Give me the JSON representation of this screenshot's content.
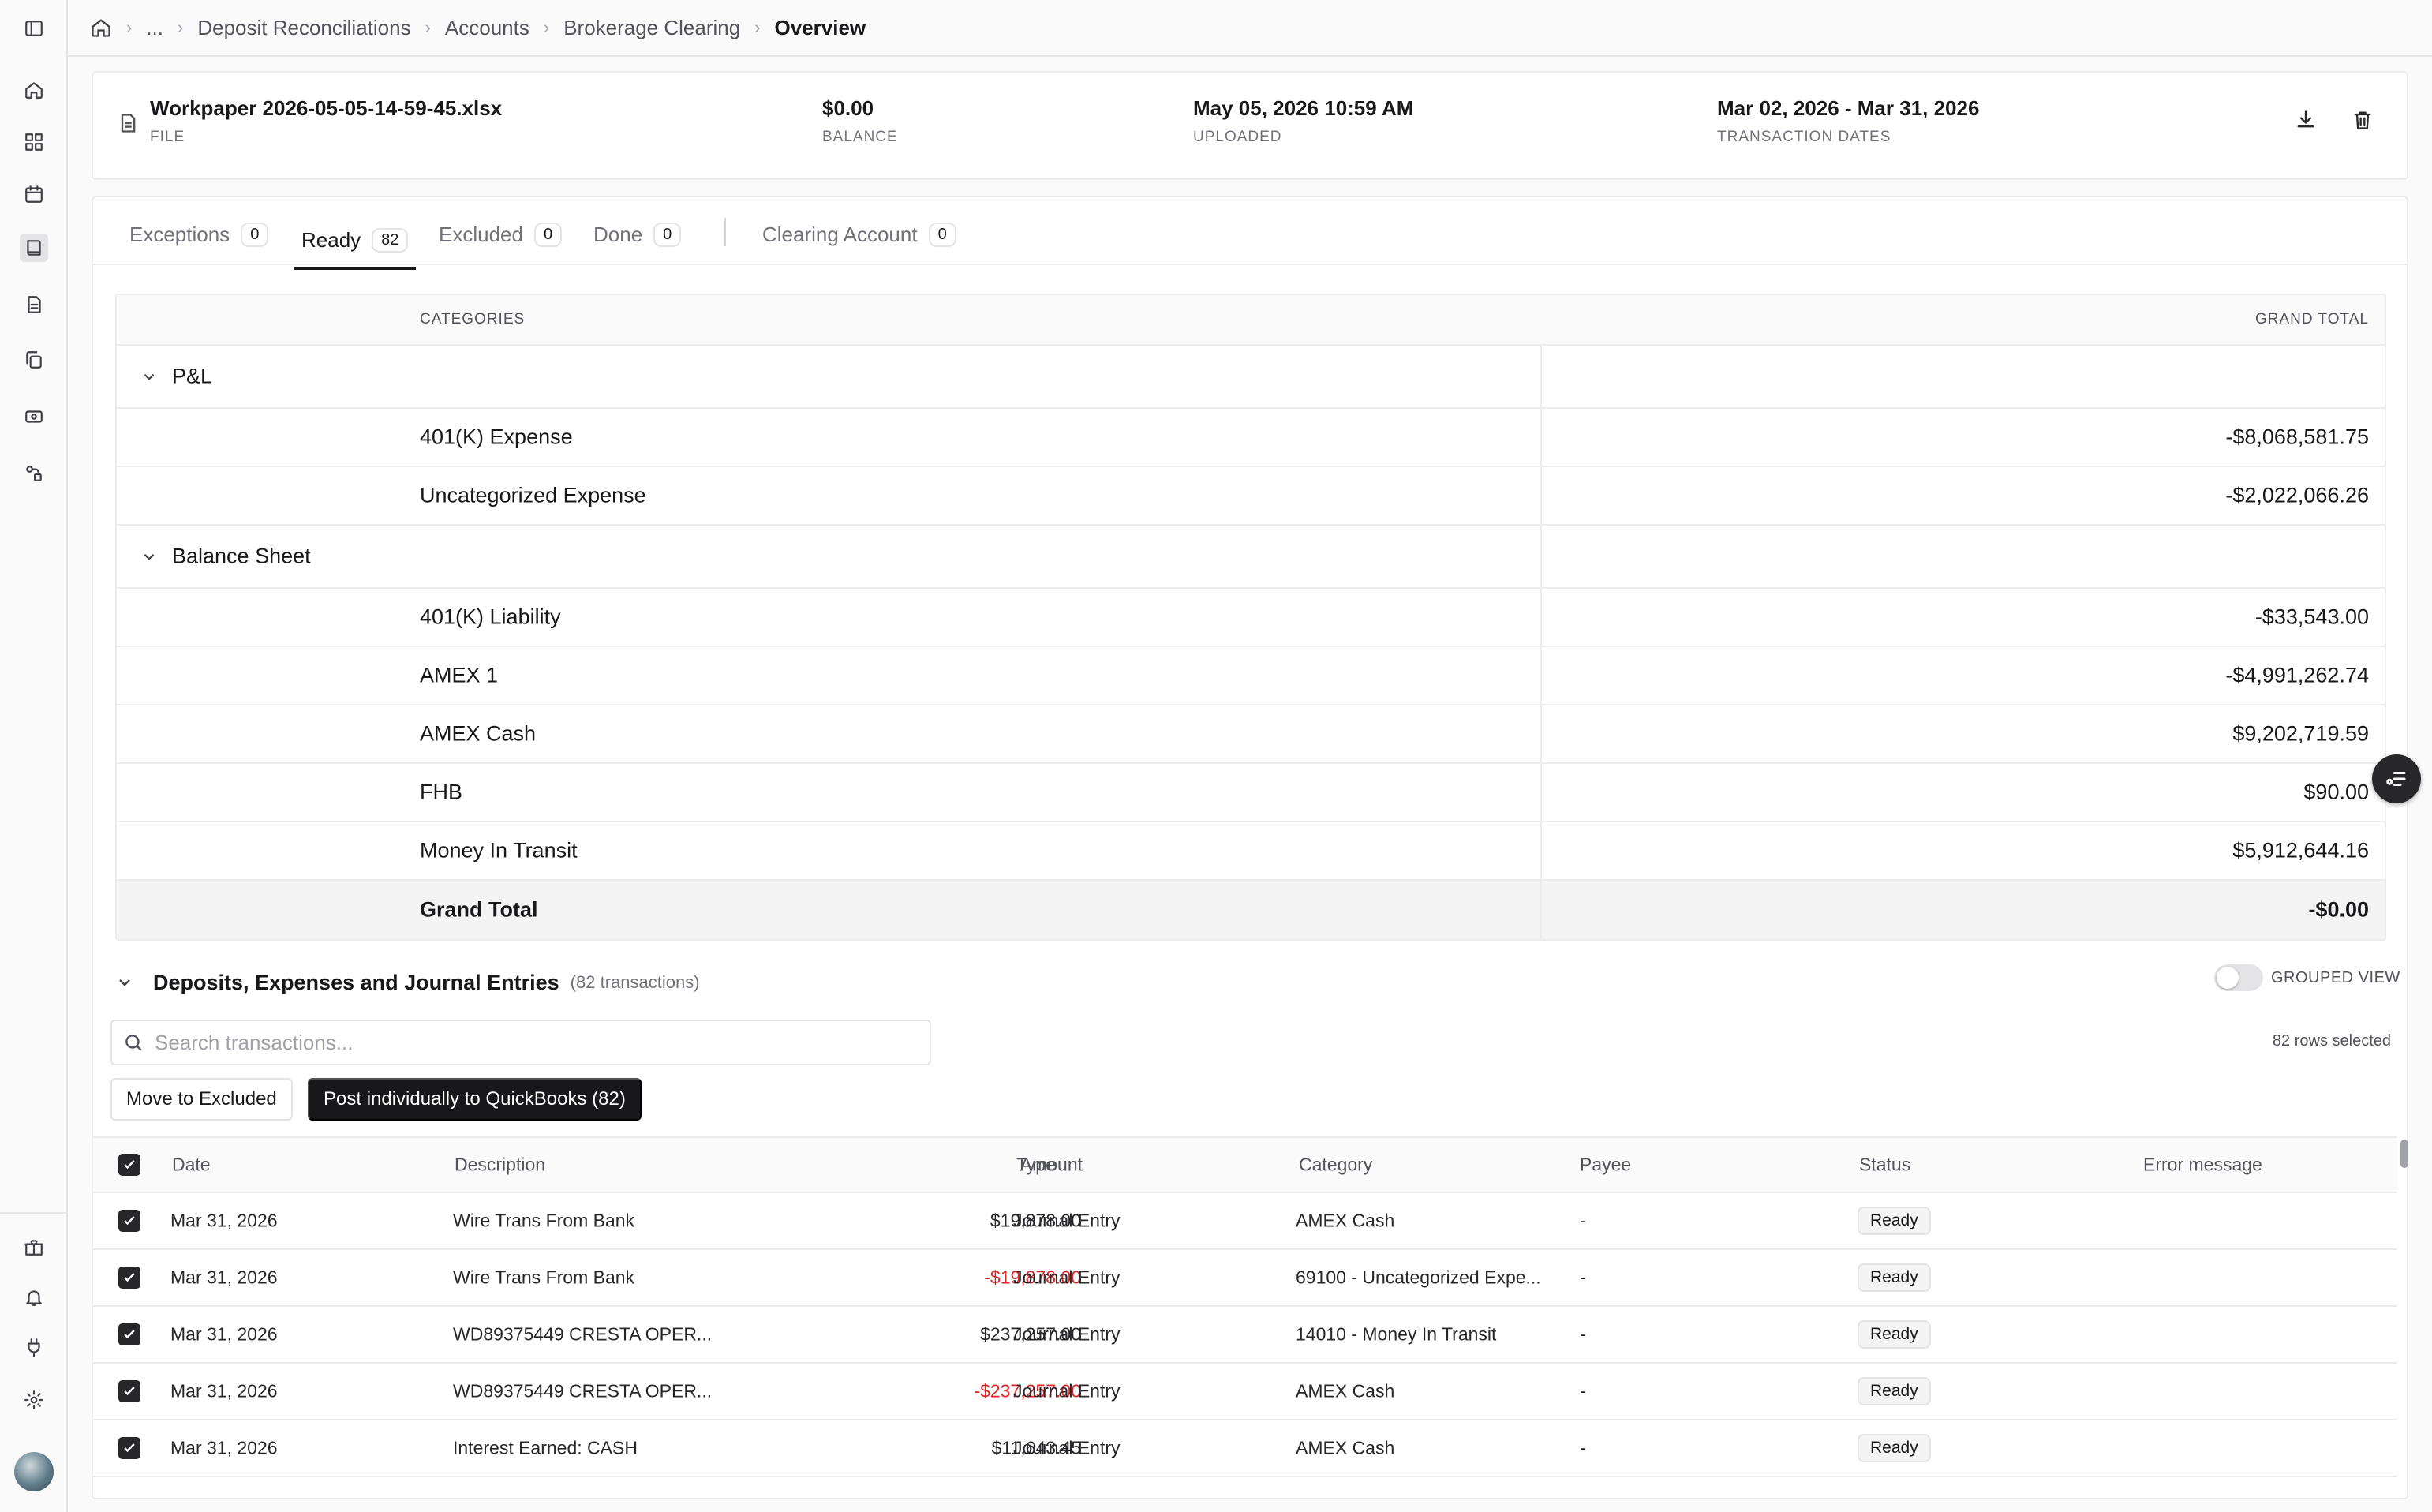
{
  "breadcrumb": {
    "ellipsis": "...",
    "items": [
      "Deposit Reconciliations",
      "Accounts",
      "Brokerage Clearing"
    ],
    "current": "Overview"
  },
  "file_card": {
    "file_name": "Workpaper 2026-05-05-14-59-45.xlsx",
    "file_label": "FILE",
    "balance": "$0.00",
    "balance_label": "BALANCE",
    "uploaded": "May 05, 2026 10:59 AM",
    "uploaded_label": "UPLOADED",
    "dates": "Mar 02, 2026 - Mar 31, 2026",
    "dates_label": "TRANSACTION DATES"
  },
  "tabs": [
    {
      "label": "Exceptions",
      "count": "0"
    },
    {
      "label": "Ready",
      "count": "82"
    },
    {
      "label": "Excluded",
      "count": "0"
    },
    {
      "label": "Done",
      "count": "0"
    },
    {
      "label": "Clearing Account",
      "count": "0"
    }
  ],
  "summary": {
    "header_categories": "CATEGORIES",
    "header_total": "GRAND TOTAL",
    "groups": [
      {
        "name": "P&L",
        "rows": [
          {
            "category": "401(K) Expense",
            "total": "-$8,068,581.75"
          },
          {
            "category": "Uncategorized Expense",
            "total": "-$2,022,066.26"
          }
        ]
      },
      {
        "name": "Balance Sheet",
        "rows": [
          {
            "category": "401(K) Liability",
            "total": "-$33,543.00"
          },
          {
            "category": "AMEX 1",
            "total": "-$4,991,262.74"
          },
          {
            "category": "AMEX Cash",
            "total": "$9,202,719.59"
          },
          {
            "category": "FHB",
            "total": "$90.00"
          },
          {
            "category": "Money In Transit",
            "total": "$5,912,644.16"
          }
        ]
      }
    ],
    "grand_total_label": "Grand Total",
    "grand_total": "-$0.00"
  },
  "section": {
    "title": "Deposits, Expenses and Journal Entries",
    "count": "(82 transactions)",
    "grouped_view_label": "GROUPED VIEW",
    "grouped_view_on": false,
    "search_placeholder": "Search transactions...",
    "rows_selected": "82 rows selected",
    "move_button": "Move to Excluded",
    "post_button": "Post individually to QuickBooks (82)"
  },
  "table": {
    "headers": {
      "date": "Date",
      "description": "Description",
      "amount": "Amount",
      "type": "Type",
      "category": "Category",
      "payee": "Payee",
      "status": "Status",
      "error": "Error message"
    },
    "rows": [
      {
        "date": "Mar 31, 2026",
        "description": "Wire Trans From Bank",
        "amount": "$19,878.00",
        "negative": false,
        "type": "Journal Entry",
        "category": "AMEX Cash",
        "payee": "-",
        "status": "Ready"
      },
      {
        "date": "Mar 31, 2026",
        "description": "Wire Trans From Bank",
        "amount": "-$19,878.00",
        "negative": true,
        "type": "Journal Entry",
        "category": "69100 - Uncategorized Expe...",
        "payee": "-",
        "status": "Ready"
      },
      {
        "date": "Mar 31, 2026",
        "description": "WD89375449 CRESTA OPER...",
        "amount": "$237,257.00",
        "negative": false,
        "type": "Journal Entry",
        "category": "14010 - Money In Transit",
        "payee": "-",
        "status": "Ready"
      },
      {
        "date": "Mar 31, 2026",
        "description": "WD89375449 CRESTA OPER...",
        "amount": "-$237,257.00",
        "negative": true,
        "type": "Journal Entry",
        "category": "AMEX Cash",
        "payee": "-",
        "status": "Ready"
      },
      {
        "date": "Mar 31, 2026",
        "description": "Interest Earned: CASH",
        "amount": "$11,643.45",
        "negative": false,
        "type": "Journal Entry",
        "category": "AMEX Cash",
        "payee": "-",
        "status": "Ready"
      }
    ]
  },
  "colors": {
    "accent": "#18181b",
    "negative": "#dc2626",
    "border": "#ececec"
  }
}
